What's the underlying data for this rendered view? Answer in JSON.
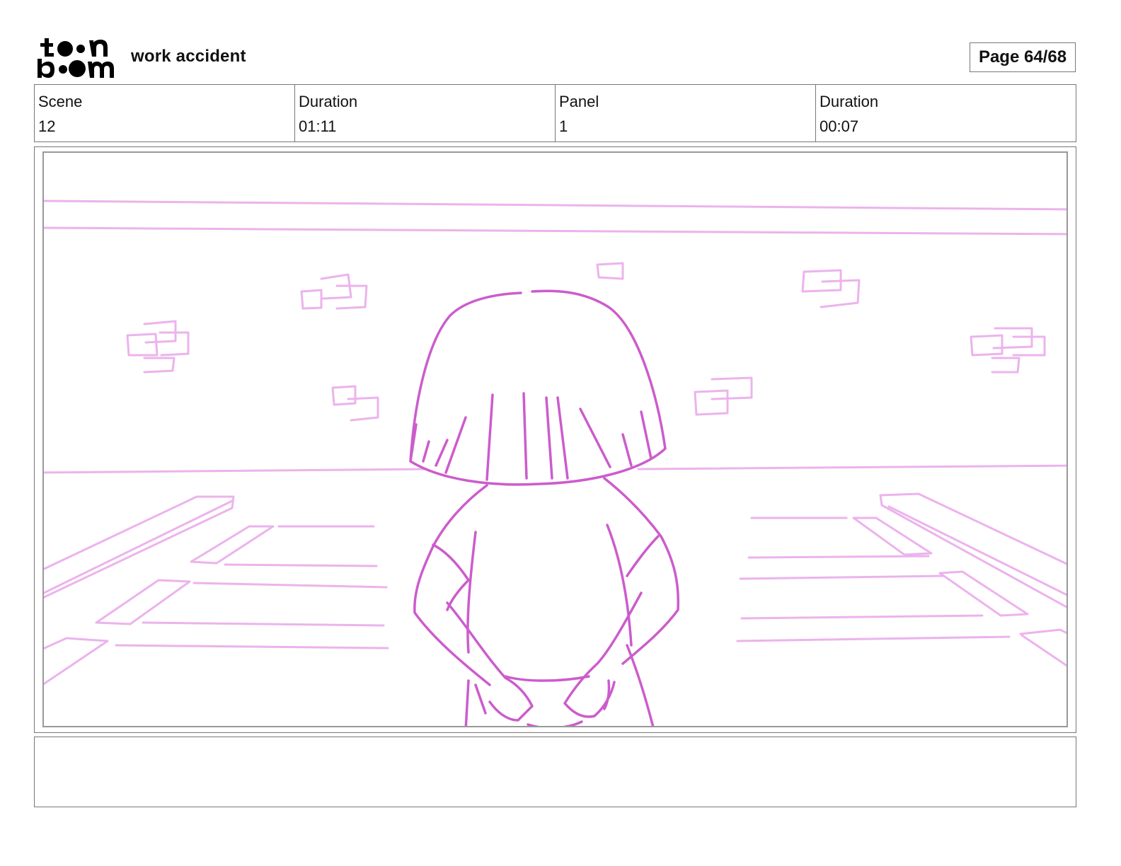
{
  "header": {
    "logo_text": "toonboom",
    "project_title": "work accident",
    "page_label": "Page 64/68"
  },
  "info": {
    "scene_label": "Scene",
    "scene_value": "12",
    "scene_duration_label": "Duration",
    "scene_duration_value": "01:11",
    "panel_label": "Panel",
    "panel_value": "1",
    "panel_duration_label": "Duration",
    "panel_duration_value": "00:07"
  },
  "notes": {
    "text": ""
  },
  "colors": {
    "figure_stroke": "#cc5ccc",
    "background_stroke": "#ecb3ec",
    "frame_border": "#777777"
  }
}
